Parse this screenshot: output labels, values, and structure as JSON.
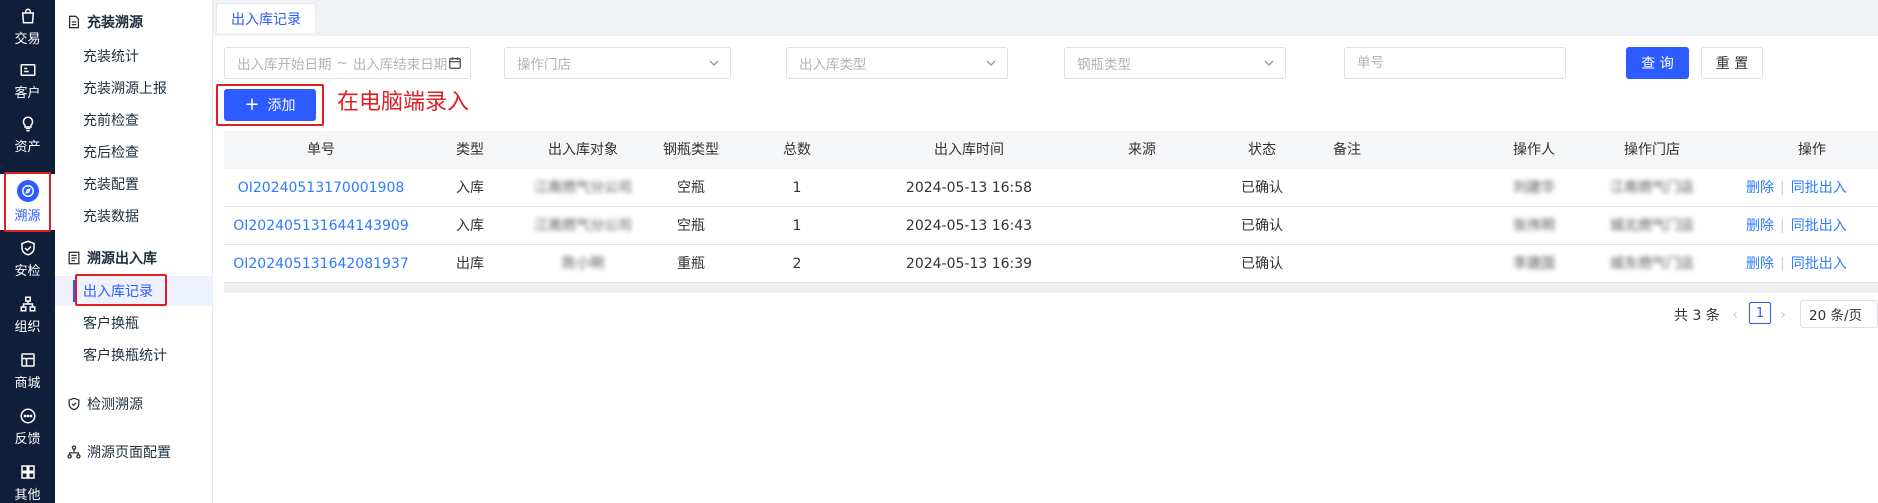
{
  "rail": {
    "items": [
      {
        "label": "交易",
        "icon": "bag-icon"
      },
      {
        "label": "客户",
        "icon": "id-card-icon"
      },
      {
        "label": "资产",
        "icon": "bulb-icon"
      },
      {
        "label": "溯源",
        "icon": "compass-icon",
        "active": true
      },
      {
        "label": "安检",
        "icon": "shield-check-icon"
      },
      {
        "label": "组织",
        "icon": "org-chart-icon"
      },
      {
        "label": "商城",
        "icon": "store-icon"
      },
      {
        "label": "反馈",
        "icon": "chat-bubble-icon"
      },
      {
        "label": "其他",
        "icon": "grid-icon"
      }
    ]
  },
  "menu": {
    "groups": [
      {
        "title": "充装溯源",
        "icon": "document-icon",
        "items": [
          "充装统计",
          "充装溯源上报",
          "充前检查",
          "充后检查",
          "充装配置",
          "充装数据"
        ]
      },
      {
        "title": "溯源出入库",
        "icon": "document-icon",
        "items": [
          "出入库记录",
          "客户换瓶",
          "客户换瓶统计"
        ]
      },
      {
        "title": "检测溯源",
        "icon": "shield-icon",
        "items": []
      },
      {
        "title": "溯源页面配置",
        "icon": "tree-icon",
        "items": []
      }
    ],
    "active_item": "出入库记录"
  },
  "tabs": [
    {
      "label": "出入库记录",
      "active": true
    }
  ],
  "filters": {
    "date_start_placeholder": "出入库开始日期",
    "date_sep": "~",
    "date_end_placeholder": "出入库结束日期",
    "store_placeholder": "操作门店",
    "inout_type_placeholder": "出入库类型",
    "cylinder_type_placeholder": "钢瓶类型",
    "order_no_placeholder": "单号",
    "search_label": "查 询",
    "reset_label": "重 置"
  },
  "add_button": {
    "label": "添加",
    "icon": "plus-icon"
  },
  "annotation": "在电脑端录入",
  "table": {
    "columns": [
      "单号",
      "类型",
      "出入库对象",
      "钢瓶类型",
      "总数",
      "出入库时间",
      "来源",
      "状态",
      "备注",
      "操作人",
      "操作门店",
      "操作"
    ],
    "rows": [
      {
        "order_no": "OI20240513170001908",
        "type": "入库",
        "target": "江南燃气分公司",
        "cylinder": "空瓶",
        "total": "1",
        "time": "2024-05-13 16:58",
        "source": "",
        "status": "已确认",
        "remark": "",
        "operator": "刘建华",
        "store": "江南燃气门店",
        "op_delete": "删除",
        "op_batch_out": "同批出入"
      },
      {
        "order_no": "OI202405131644143909",
        "type": "入库",
        "target": "江南燃气分公司",
        "cylinder": "空瓶",
        "total": "1",
        "time": "2024-05-13 16:43",
        "source": "",
        "status": "已确认",
        "remark": "",
        "operator": "张伟明",
        "store": "城北燃气门店",
        "op_delete": "删除",
        "op_batch_out": "同批出入"
      },
      {
        "order_no": "OI202405131642081937",
        "type": "出库",
        "target": "陈小明",
        "cylinder": "重瓶",
        "total": "2",
        "time": "2024-05-13 16:39",
        "source": "",
        "status": "已确认",
        "remark": "",
        "operator": "李建国",
        "store": "城东燃气门店",
        "op_delete": "删除",
        "op_batch_out": "同批出入"
      }
    ]
  },
  "pagination": {
    "total_text": "共 3 条",
    "current_page": "1",
    "page_size": "20 条/页"
  },
  "colors": {
    "primary": "#2d5bff",
    "link": "#2d7bff",
    "rail_bg": "#0f1f3a",
    "highlight": "#e02020"
  }
}
